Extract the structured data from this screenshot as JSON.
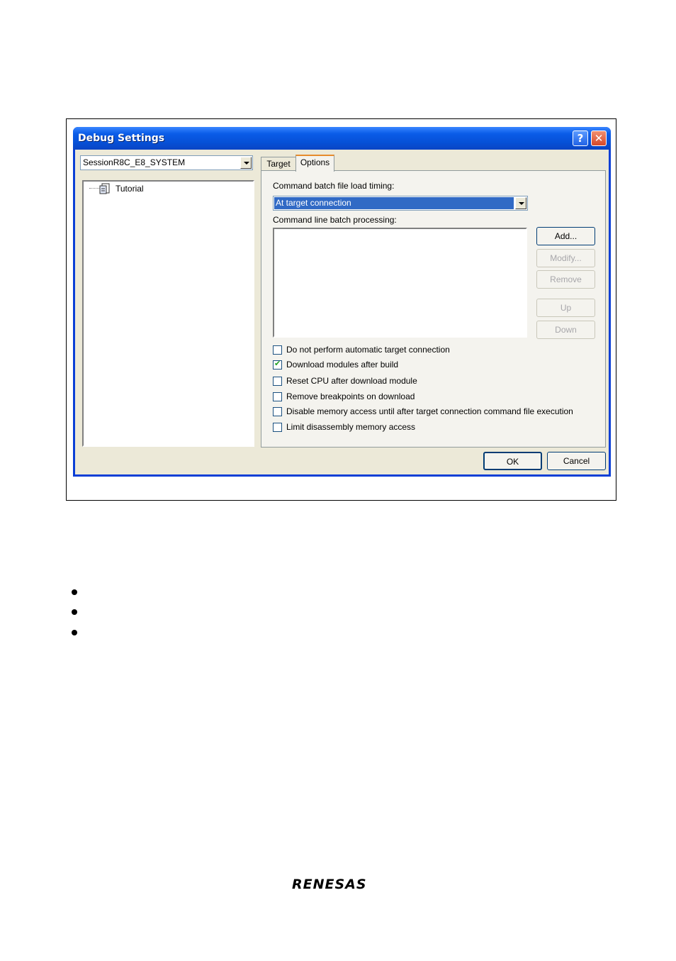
{
  "dialog": {
    "title": "Debug Settings",
    "help_glyph": "?",
    "close_glyph": "✕",
    "session": "SessionR8C_E8_SYSTEM",
    "tree_item": "Tutorial",
    "tabs": [
      {
        "label": "Target"
      },
      {
        "label": "Options"
      }
    ],
    "options": {
      "batch_timing_label": "Command batch file load timing:",
      "batch_timing_value": "At target connection",
      "batch_processing_label": "Command line batch processing:",
      "buttons": {
        "add": "Add...",
        "modify": "Modify...",
        "remove": "Remove",
        "up": "Up",
        "down": "Down"
      },
      "checkboxes": [
        {
          "label": "Do not perform automatic target connection",
          "checked": false
        },
        {
          "label": "Download modules after build",
          "checked": true
        },
        {
          "label": "Reset CPU after download module",
          "checked": false
        },
        {
          "label": "Remove breakpoints on download",
          "checked": false
        },
        {
          "label": "Disable memory access until after target connection command file execution",
          "checked": false
        },
        {
          "label": "Limit disassembly memory access",
          "checked": false
        }
      ]
    },
    "ok": "OK",
    "cancel": "Cancel"
  },
  "footer": {
    "logo": "RENESAS"
  }
}
